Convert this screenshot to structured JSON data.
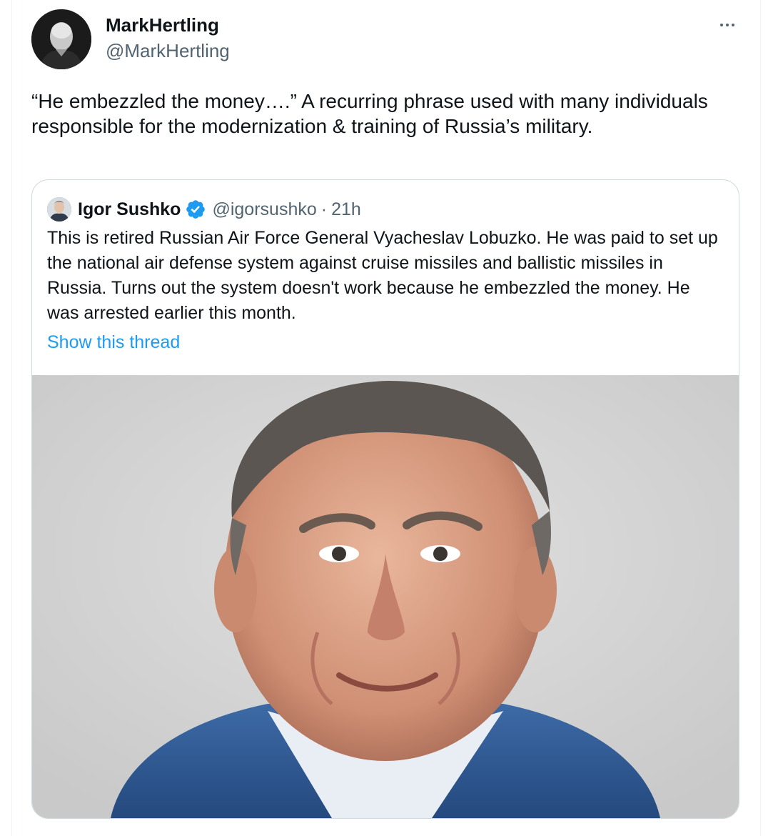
{
  "tweet": {
    "author_name": "MarkHertling",
    "author_handle": "@MarkHertling",
    "text": "“He embezzled the money….”  A recurring phrase used with many individuals responsible for the modernization & training of Russia’s military."
  },
  "quoted_tweet": {
    "author_name": "Igor Sushko",
    "author_handle": "@igorsushko",
    "separator": "·",
    "time": "21h",
    "verified": true,
    "text": "This is retired Russian Air Force General Vyacheslav Lobuzko. He was paid to set up the national air defense system against cruise missiles and ballistic missiles in Russia. Turns out the system doesn't work because he embezzled the money. He was arrested earlier this month.",
    "show_thread_label": "Show this thread"
  },
  "icons": {
    "more": "more-options-icon",
    "verified": "verified-badge-icon"
  },
  "colors": {
    "link": "#1d9bf0",
    "secondary_text": "#536471",
    "verified": "#1d9bf0",
    "border": "#cfd9de"
  }
}
